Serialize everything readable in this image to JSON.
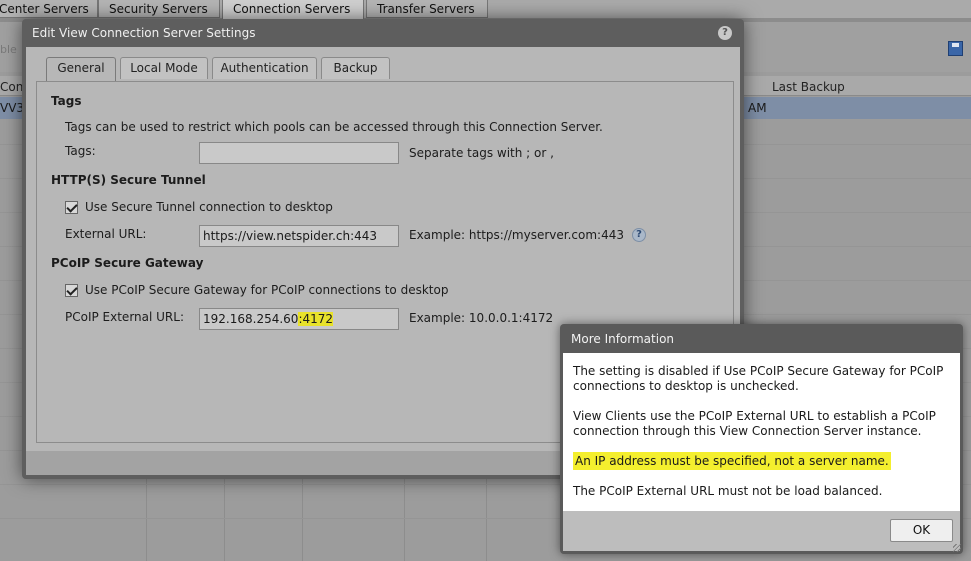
{
  "background": {
    "tabs": [
      "Center Servers",
      "Security Servers",
      "Connection Servers",
      "Transfer Servers"
    ],
    "disabled_label": "ble",
    "columns": {
      "first": "Con",
      "last_backup": "Last Backup"
    },
    "row": {
      "first": "VV3",
      "time_suffix": "AM"
    }
  },
  "dialog": {
    "title": "Edit View Connection Server Settings",
    "help_glyph": "?",
    "tabs": [
      {
        "label": "General",
        "active": true
      },
      {
        "label": "Local Mode",
        "active": false
      },
      {
        "label": "Authentication",
        "active": false
      },
      {
        "label": "Backup",
        "active": false
      }
    ],
    "tags": {
      "section_title": "Tags",
      "description": "Tags can be used to restrict which pools can be accessed through this Connection Server.",
      "field_label": "Tags:",
      "value": "",
      "hint": "Separate tags with ; or ,"
    },
    "tunnel": {
      "section_title": "HTTP(S) Secure Tunnel",
      "checkbox_label": "Use Secure Tunnel connection to desktop",
      "checked": true,
      "field_label": "External URL:",
      "value": "https://view.netspider.ch:443",
      "example": "Example: https://myserver.com:443",
      "info_glyph": "?"
    },
    "pcoip": {
      "section_title": "PCoIP Secure Gateway",
      "checkbox_label": "Use PCoIP Secure Gateway for PCoIP connections to desktop",
      "checked": true,
      "field_label": "PCoIP External URL:",
      "value_host": "192.168.254.60",
      "value_port": ":4172",
      "example": "Example: 10.0.0.1:4172"
    }
  },
  "popup": {
    "title": "More Information",
    "paragraphs": [
      "The setting is disabled if Use PCoIP Secure Gateway for PCoIP connections to desktop is unchecked.",
      "View Clients use the PCoIP External URL to establish a PCoIP connection through this View Connection Server instance.",
      "An IP address must be specified, not a server name.",
      "The PCoIP External URL must not be load balanced."
    ],
    "ok_label": "OK"
  },
  "colors": {
    "highlight": "#f4ef2e",
    "dialog_frame": "#5e5e5e",
    "panel": "#b7b7b7"
  }
}
